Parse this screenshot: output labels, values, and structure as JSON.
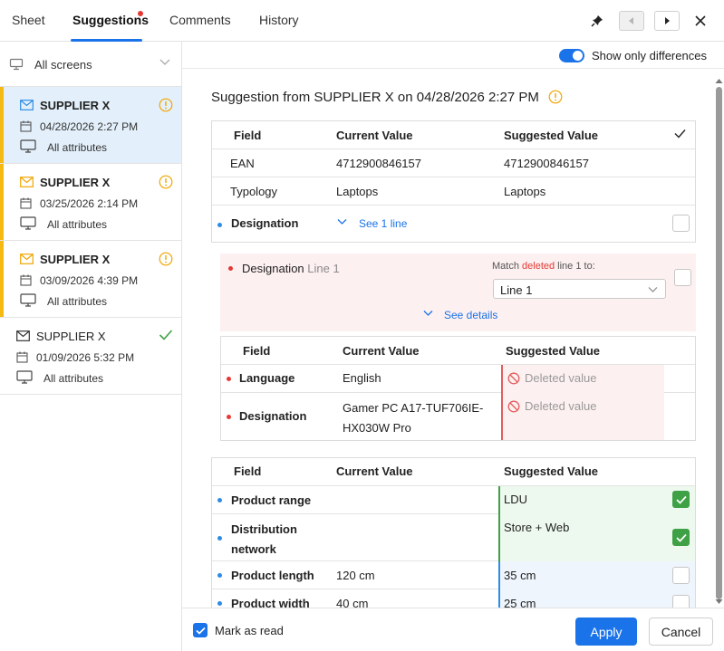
{
  "tabs": [
    {
      "label": "Sheet"
    },
    {
      "label": "Suggestions"
    },
    {
      "label": "Comments"
    },
    {
      "label": "History"
    }
  ],
  "sidebar": {
    "screens_label": "All screens",
    "cards": [
      {
        "title": "SUPPLIER X",
        "date": "04/28/2026 2:27 PM",
        "scope": "All attributes",
        "status": "pending"
      },
      {
        "title": "SUPPLIER X",
        "date": "03/25/2026 2:14 PM",
        "scope": "All attributes",
        "status": "pending"
      },
      {
        "title": "SUPPLIER X",
        "date": "03/09/2026 4:39 PM",
        "scope": "All attributes",
        "status": "pending"
      },
      {
        "title": "SUPPLIER X",
        "date": "01/09/2026 5:32 PM",
        "scope": "All attributes",
        "status": "done"
      }
    ]
  },
  "main": {
    "toggle_label": "Show only differences",
    "heading": "Suggestion from SUPPLIER X on 04/28/2026 2:27 PM",
    "table1": {
      "headers": {
        "field": "Field",
        "current": "Current Value",
        "suggested": "Suggested Value"
      },
      "rows": [
        {
          "field": "EAN",
          "current": "4712900846157",
          "suggested": "4712900846157"
        },
        {
          "field": "Typology",
          "current": "Laptops",
          "suggested": "Laptops"
        },
        {
          "field": "Designation",
          "link": "See 1 line"
        }
      ]
    },
    "match": {
      "field": "Designation",
      "line": "Line 1",
      "prefix": "Match ",
      "deleted_word": "deleted",
      "suffix": " line 1 to:",
      "select_value": "Line 1",
      "details_link": "See details"
    },
    "details_table": {
      "headers": {
        "field": "Field",
        "current": "Current Value",
        "suggested": "Suggested Value"
      },
      "rows": [
        {
          "field": "Language",
          "current": "English",
          "suggested": "Deleted value"
        },
        {
          "field": "Designation",
          "current": "Gamer PC A17-TUF706IE-HX030W Pro",
          "suggested": "Deleted value"
        }
      ]
    },
    "table2": {
      "headers": {
        "field": "Field",
        "current": "Current Value",
        "suggested": "Suggested Value"
      },
      "rows": [
        {
          "field": "Product range",
          "current": "",
          "suggested": "LDU",
          "checked": true
        },
        {
          "field": "Distribution network",
          "current": "",
          "suggested": "Store + Web",
          "checked": true
        },
        {
          "field": "Product length",
          "current": "120 cm",
          "suggested": "35 cm",
          "checked": false
        },
        {
          "field": "Product width",
          "current": "40 cm",
          "suggested": "25 cm",
          "checked": false
        }
      ]
    }
  },
  "footer": {
    "mark_as_read": "Mark as read",
    "apply": "Apply",
    "cancel": "Cancel"
  },
  "colors": {
    "accent": "#1a73e8",
    "pending": "#f5b914",
    "success": "#3fa146",
    "danger": "#e53935"
  }
}
